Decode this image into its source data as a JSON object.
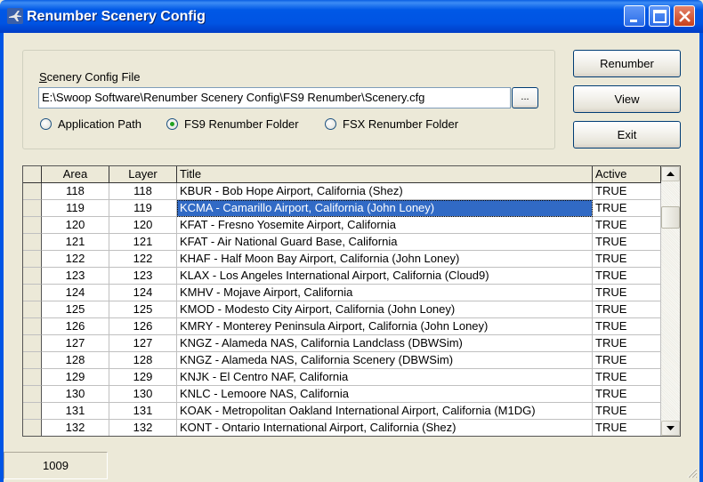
{
  "window": {
    "title": "Renumber Scenery Config",
    "icon": "airplane-icon",
    "controls": [
      "minimize-icon",
      "maximize-icon",
      "close-icon"
    ]
  },
  "config": {
    "file_label": "Scenery Config File",
    "path_value": "E:\\Swoop Software\\Renumber Scenery Config\\FS9 Renumber\\Scenery.cfg",
    "browse_label": "...",
    "radios": [
      {
        "label": "Application Path",
        "selected": false
      },
      {
        "label": "FS9 Renumber Folder",
        "selected": true
      },
      {
        "label": "FSX Renumber Folder",
        "selected": false
      }
    ]
  },
  "buttons": {
    "renumber": "Renumber",
    "view": "View",
    "exit": "Exit"
  },
  "grid": {
    "headers": {
      "area": "Area",
      "layer": "Layer",
      "title": "Title",
      "active": "Active"
    },
    "rows": [
      {
        "area": "118",
        "layer": "118",
        "title": "KBUR - Bob Hope Airport, California (Shez)",
        "active": "TRUE"
      },
      {
        "area": "119",
        "layer": "119",
        "title": "KCMA - Camarillo Airport, California (John Loney)",
        "active": "TRUE",
        "selected": true
      },
      {
        "area": "120",
        "layer": "120",
        "title": "KFAT - Fresno Yosemite Airport, California",
        "active": "TRUE"
      },
      {
        "area": "121",
        "layer": "121",
        "title": "KFAT - Air National Guard Base, California",
        "active": "TRUE"
      },
      {
        "area": "122",
        "layer": "122",
        "title": "KHAF - Half Moon Bay Airport, California (John Loney)",
        "active": "TRUE"
      },
      {
        "area": "123",
        "layer": "123",
        "title": "KLAX - Los Angeles International Airport, California (Cloud9)",
        "active": "TRUE"
      },
      {
        "area": "124",
        "layer": "124",
        "title": "KMHV - Mojave Airport, California",
        "active": "TRUE"
      },
      {
        "area": "125",
        "layer": "125",
        "title": "KMOD - Modesto City Airport, California (John Loney)",
        "active": "TRUE"
      },
      {
        "area": "126",
        "layer": "126",
        "title": "KMRY - Monterey Peninsula Airport, California (John Loney)",
        "active": "TRUE"
      },
      {
        "area": "127",
        "layer": "127",
        "title": "KNGZ - Alameda NAS, California Landclass (DBWSim)",
        "active": "TRUE"
      },
      {
        "area": "128",
        "layer": "128",
        "title": "KNGZ - Alameda NAS, California Scenery (DBWSim)",
        "active": "TRUE"
      },
      {
        "area": "129",
        "layer": "129",
        "title": "KNJK - El Centro NAF, California",
        "active": "TRUE"
      },
      {
        "area": "130",
        "layer": "130",
        "title": "KNLC - Lemoore NAS, California",
        "active": "TRUE"
      },
      {
        "area": "131",
        "layer": "131",
        "title": "KOAK - Metropolitan Oakland International Airport, California (M1DG)",
        "active": "TRUE"
      },
      {
        "area": "132",
        "layer": "132",
        "title": "KONT - Ontario International Airport, California  (Shez)",
        "active": "TRUE"
      }
    ]
  },
  "status": {
    "count": "1009"
  }
}
